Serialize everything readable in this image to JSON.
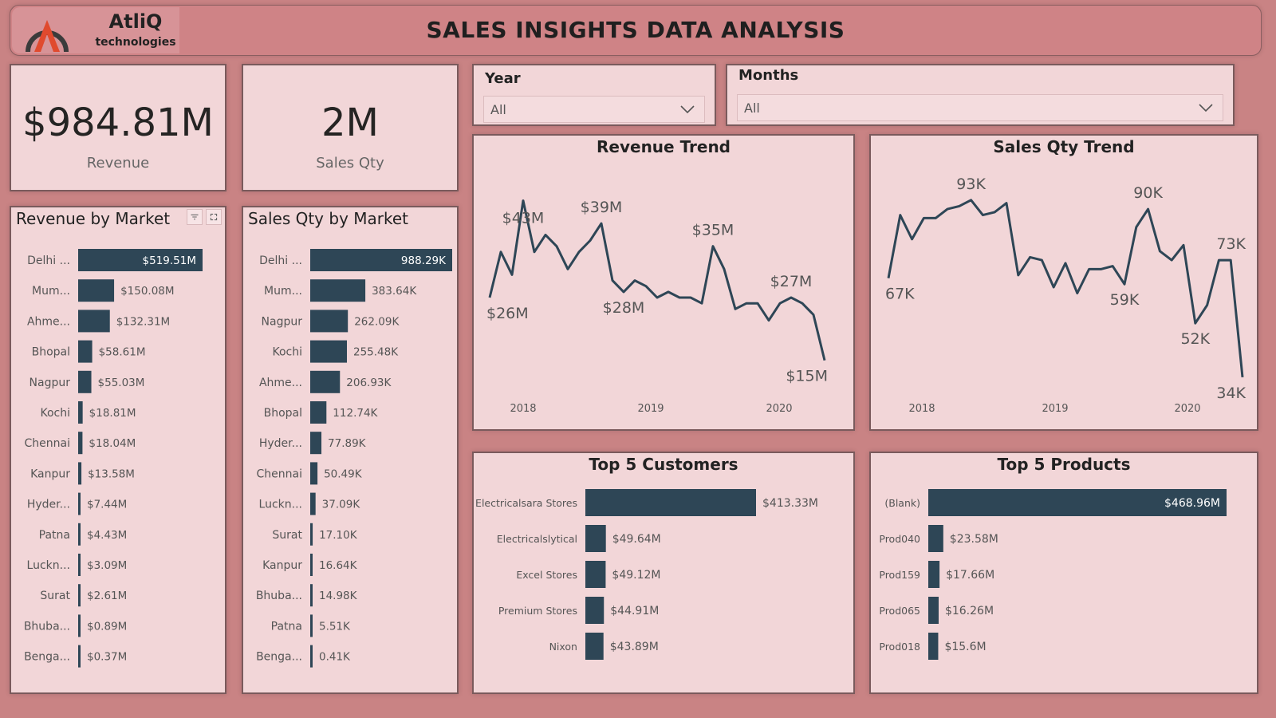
{
  "header": {
    "brand": "AtliQ",
    "brand_sub": "technologies",
    "title": "SALES INSIGHTS DATA ANALYSIS"
  },
  "kpis": {
    "revenue": {
      "value": "$984.81M",
      "label": "Revenue"
    },
    "sales_qty": {
      "value": "2M",
      "label": "Sales Qty"
    }
  },
  "slicers": {
    "year": {
      "title": "Year",
      "value": "All"
    },
    "months": {
      "title": "Months",
      "value": "All"
    }
  },
  "colors": {
    "bar": "#2e4656",
    "panel": "#f2d6d8",
    "background": "#c98384",
    "label": "#555555"
  },
  "chart_data": [
    {
      "id": "revenue_by_market",
      "type": "bar",
      "orientation": "horizontal",
      "title": "Revenue by Market",
      "categories": [
        "Delhi ...",
        "Mum...",
        "Ahme...",
        "Bhopal",
        "Nagpur",
        "Kochi",
        "Chennai",
        "Kanpur",
        "Hyder...",
        "Patna",
        "Luckn...",
        "Surat",
        "Bhuba...",
        "Benga..."
      ],
      "values": [
        519.51,
        150.08,
        132.31,
        58.61,
        55.03,
        18.81,
        18.04,
        13.58,
        7.44,
        4.43,
        3.09,
        2.61,
        0.89,
        0.37
      ],
      "labels": [
        "$519.51M",
        "$150.08M",
        "$132.31M",
        "$58.61M",
        "$55.03M",
        "$18.81M",
        "$18.04M",
        "$13.58M",
        "$7.44M",
        "$4.43M",
        "$3.09M",
        "$2.61M",
        "$0.89M",
        "$0.37M"
      ]
    },
    {
      "id": "sales_qty_by_market",
      "type": "bar",
      "orientation": "horizontal",
      "title": "Sales Qty by Market",
      "categories": [
        "Delhi ...",
        "Mum...",
        "Nagpur",
        "Kochi",
        "Ahme...",
        "Bhopal",
        "Hyder...",
        "Chennai",
        "Luckn...",
        "Surat",
        "Kanpur",
        "Bhuba...",
        "Patna",
        "Benga..."
      ],
      "values": [
        988.29,
        383.64,
        262.09,
        255.48,
        206.93,
        112.74,
        77.89,
        50.49,
        37.09,
        17.1,
        16.64,
        14.98,
        5.51,
        0.41
      ],
      "labels": [
        "988.29K",
        "383.64K",
        "262.09K",
        "255.48K",
        "206.93K",
        "112.74K",
        "77.89K",
        "50.49K",
        "37.09K",
        "17.10K",
        "16.64K",
        "14.98K",
        "5.51K",
        "0.41K"
      ]
    },
    {
      "id": "revenue_trend",
      "type": "line",
      "title": "Revenue Trend",
      "x_ticks": [
        "2018",
        "2019",
        "2020"
      ],
      "values": [
        26,
        34,
        30,
        43,
        34,
        37,
        35,
        31,
        34,
        36,
        39,
        29,
        27,
        29,
        28,
        26,
        27,
        26,
        26,
        25,
        35,
        31,
        24,
        25,
        25,
        22,
        25,
        26,
        25,
        23,
        15
      ],
      "ylim": [
        13,
        46
      ],
      "annotations": [
        {
          "index": 3,
          "label": "$43M",
          "pos": "right"
        },
        {
          "index": 0,
          "label": "$26M",
          "pos": "below"
        },
        {
          "index": 10,
          "label": "$39M",
          "pos": "above"
        },
        {
          "index": 12,
          "label": "$28M",
          "pos": "below"
        },
        {
          "index": 20,
          "label": "$35M",
          "pos": "above"
        },
        {
          "index": 27,
          "label": "$27M",
          "pos": "above"
        },
        {
          "index": 30,
          "label": "$15M",
          "pos": "below"
        }
      ]
    },
    {
      "id": "sales_qty_trend",
      "type": "line",
      "title": "Sales Qty Trend",
      "x_ticks": [
        "2018",
        "2019",
        "2020"
      ],
      "values": [
        67,
        88,
        80,
        87,
        87,
        90,
        91,
        93,
        88,
        89,
        92,
        68,
        74,
        73,
        64,
        72,
        62,
        70,
        70,
        71,
        65,
        84,
        90,
        76,
        73,
        78,
        52,
        58,
        73,
        73,
        34
      ],
      "ylim": [
        30,
        98
      ],
      "annotations": [
        {
          "index": 0,
          "label": "67K",
          "pos": "below"
        },
        {
          "index": 7,
          "label": "93K",
          "pos": "above"
        },
        {
          "index": 22,
          "label": "90K",
          "pos": "above"
        },
        {
          "index": 20,
          "label": "59K",
          "pos": "below"
        },
        {
          "index": 26,
          "label": "52K",
          "pos": "below"
        },
        {
          "index": 29,
          "label": "73K",
          "pos": "above"
        },
        {
          "index": 30,
          "label": "34K",
          "pos": "below"
        }
      ]
    },
    {
      "id": "top5_customers",
      "type": "bar",
      "orientation": "horizontal",
      "title": "Top 5 Customers",
      "categories": [
        "Electricalsara Stores",
        "Electricalslytical",
        "Excel Stores",
        "Premium Stores",
        "Nixon"
      ],
      "values": [
        413.33,
        49.64,
        49.12,
        44.91,
        43.89
      ],
      "labels": [
        "$413.33M",
        "$49.64M",
        "$49.12M",
        "$44.91M",
        "$43.89M"
      ]
    },
    {
      "id": "top5_products",
      "type": "bar",
      "orientation": "horizontal",
      "title": "Top 5 Products",
      "categories": [
        "(Blank)",
        "Prod040",
        "Prod159",
        "Prod065",
        "Prod018"
      ],
      "values": [
        468.96,
        23.58,
        17.66,
        16.26,
        15.6
      ],
      "labels": [
        "$468.96M",
        "$23.58M",
        "$17.66M",
        "$16.26M",
        "$15.6M"
      ]
    }
  ]
}
